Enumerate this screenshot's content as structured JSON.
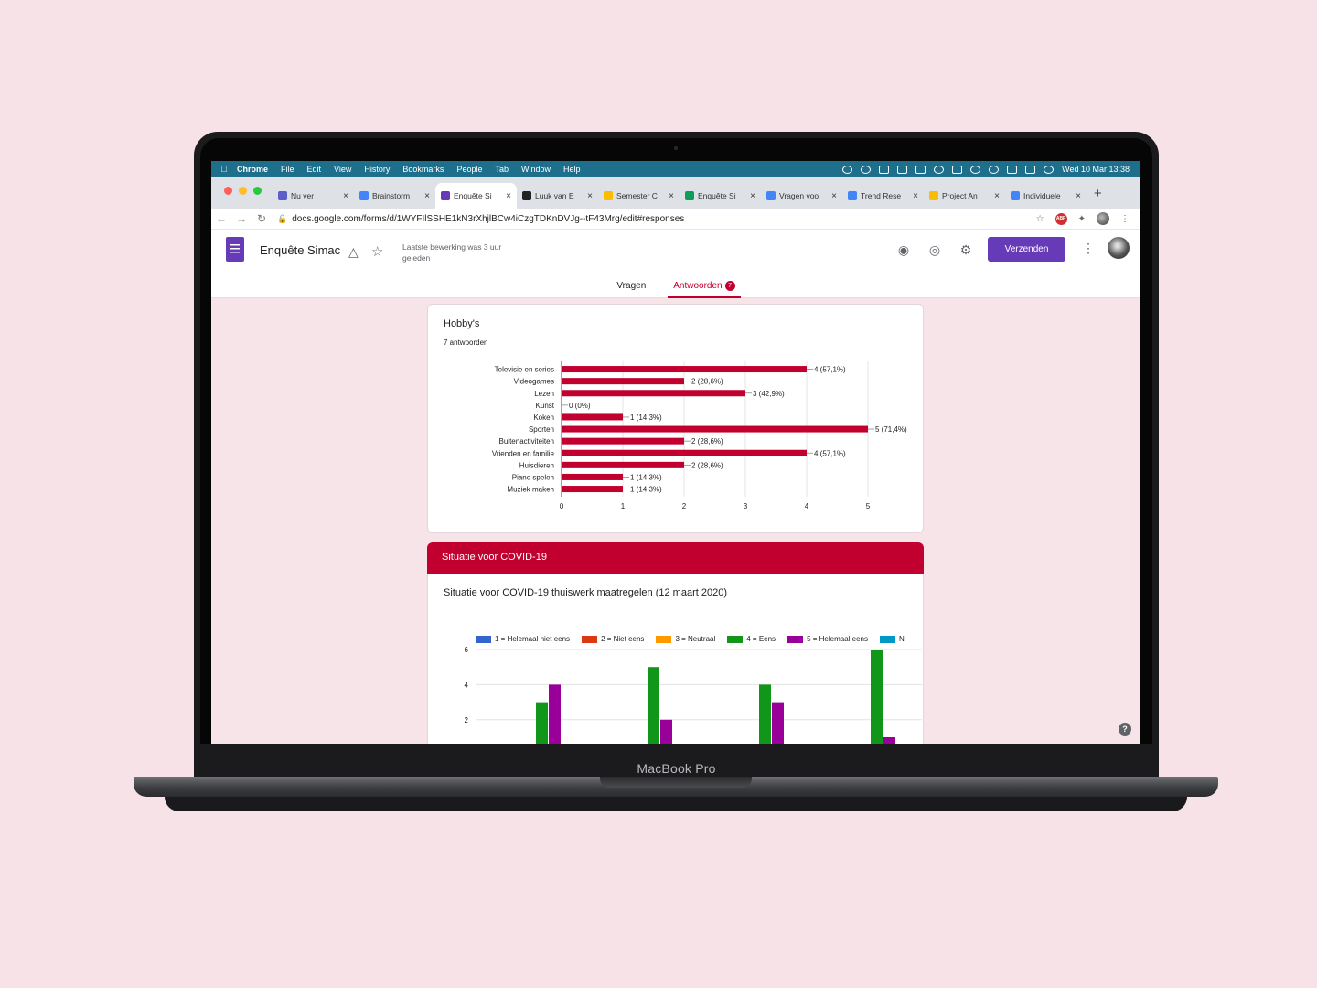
{
  "device": {
    "label": "MacBook Pro"
  },
  "menubar": {
    "app": "Chrome",
    "items": [
      "File",
      "Edit",
      "View",
      "History",
      "Bookmarks",
      "People",
      "Tab",
      "Window",
      "Help"
    ],
    "clock": "Wed 10 Mar  13:38"
  },
  "tabs": [
    {
      "label": "Nu ver",
      "icon": "teams-icon",
      "color": "#5b5fc7"
    },
    {
      "label": "Brainstorm",
      "icon": "docs-icon",
      "color": "#4285f4"
    },
    {
      "label": "Enquête Si",
      "icon": "forms-icon",
      "color": "#673ab7",
      "active": true
    },
    {
      "label": "Luuk van E",
      "icon": "notion-icon",
      "color": "#222222"
    },
    {
      "label": "Semester C",
      "icon": "drive-icon",
      "color": "#fbbc04"
    },
    {
      "label": "Enquête Si",
      "icon": "sheets-icon",
      "color": "#0f9d58"
    },
    {
      "label": "Vragen voo",
      "icon": "docs-icon",
      "color": "#4285f4"
    },
    {
      "label": "Trend Rese",
      "icon": "docs-icon",
      "color": "#4285f4"
    },
    {
      "label": "Project An",
      "icon": "drive-icon",
      "color": "#fbbc04"
    },
    {
      "label": "Individuele",
      "icon": "docs-icon",
      "color": "#4285f4"
    }
  ],
  "address": {
    "url": "docs.google.com/forms/d/1WYFIlSSHE1kN3rXhjlBCw4iCzgTDKnDVJg--tF43Mrg/edit#responses"
  },
  "header": {
    "title": "Enquête Simac",
    "last_edit": "Laatste bewerking was 3 uur geleden",
    "send": "Verzenden",
    "accent": "#673ab7"
  },
  "nav_tabs": {
    "questions": "Vragen",
    "responses": "Antwoorden",
    "count": "7"
  },
  "card1": {
    "title": "Hobby's",
    "subtitle": "7 antwoorden"
  },
  "section": {
    "title": "Situatie voor COVID-19"
  },
  "card2": {
    "title": "Situatie voor COVID-19 thuiswerk maatregelen (12 maart 2020)"
  },
  "chart_data": [
    {
      "type": "bar",
      "orientation": "horizontal",
      "categories": [
        "Televisie en series",
        "Videogames",
        "Lezen",
        "Kunst",
        "Koken",
        "Sporten",
        "Buitenactiviteiten",
        "Vrienden en familie",
        "Huisdieren",
        "Piano spelen",
        "Muziek maken"
      ],
      "values": [
        4,
        2,
        3,
        0,
        1,
        5,
        2,
        4,
        2,
        1,
        1
      ],
      "labels": [
        "4 (57,1%)",
        "2 (28,6%)",
        "3 (42,9%)",
        "0 (0%)",
        "1 (14,3%)",
        "5 (71,4%)",
        "2 (28,6%)",
        "4 (57,1%)",
        "2 (28,6%)",
        "1 (14,3%)",
        "1 (14,3%)"
      ],
      "xlim": [
        0,
        5
      ],
      "xticks": [
        "0",
        "1",
        "2",
        "3",
        "4",
        "5"
      ],
      "color": "#c2002f"
    },
    {
      "type": "bar",
      "orientation": "vertical",
      "ylim": [
        0,
        6
      ],
      "yticks": [
        "2",
        "4",
        "6"
      ],
      "legend_position": "top",
      "series": [
        {
          "name": "1 = Helemaal niet eens",
          "color": "#3366cc",
          "values": [
            0,
            0,
            0,
            0
          ]
        },
        {
          "name": "2 = Niet eens",
          "color": "#dc3912",
          "values": [
            0,
            0,
            0,
            0
          ]
        },
        {
          "name": "3 = Neutraal",
          "color": "#ff9900",
          "values": [
            0,
            0,
            0,
            0
          ]
        },
        {
          "name": "4 = Eens",
          "color": "#109618",
          "values": [
            3,
            5,
            4,
            6
          ]
        },
        {
          "name": "5 = Helemaal eens",
          "color": "#990099",
          "values": [
            4,
            2,
            3,
            1
          ]
        },
        {
          "name": "N",
          "color": "#0099c6",
          "values": [
            0,
            0,
            0,
            0
          ]
        }
      ]
    }
  ]
}
